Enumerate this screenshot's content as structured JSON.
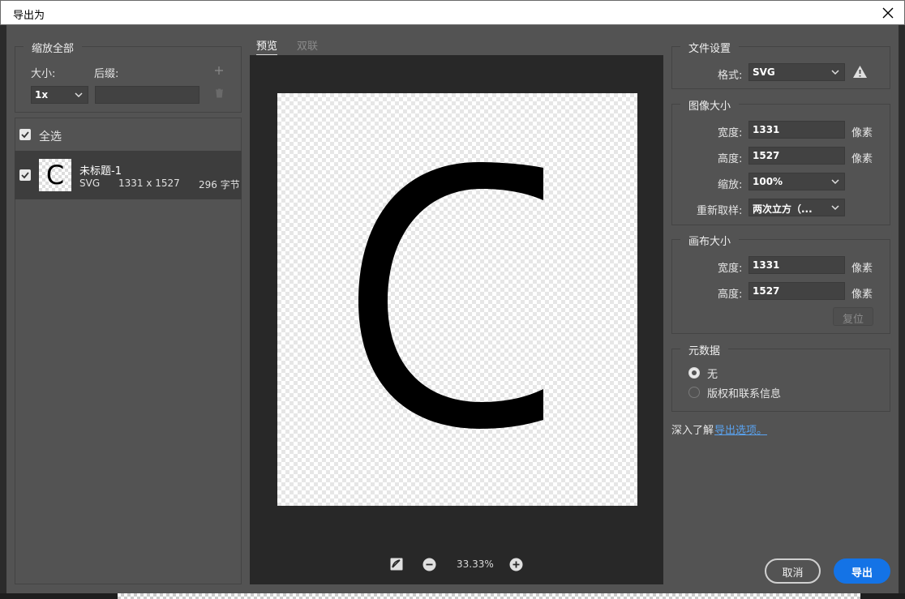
{
  "window": {
    "title": "导出为"
  },
  "scale_all": {
    "legend": "缩放全部",
    "size_label": "大小:",
    "suffix_label": "后缀:",
    "size_value": "1x",
    "suffix_value": ""
  },
  "assets": {
    "select_all_label": "全选",
    "items": [
      {
        "name": "未标题-1",
        "format": "SVG",
        "dimensions": "1331 x 1527",
        "filesize": "296 字节",
        "thumbnail_glyph": "C",
        "checked": true
      }
    ]
  },
  "preview": {
    "tabs": [
      {
        "label": "预览",
        "active": true
      },
      {
        "label": "双联",
        "active": false
      }
    ],
    "canvas_glyph": "C",
    "zoom": "33.33%"
  },
  "file_settings": {
    "legend": "文件设置",
    "format_label": "格式:",
    "format_value": "SVG"
  },
  "image_size": {
    "legend": "图像大小",
    "width_label": "宽度:",
    "width_value": "1331",
    "height_label": "高度:",
    "height_value": "1527",
    "unit": "像素",
    "scale_label": "缩放:",
    "scale_value": "100%",
    "resample_label": "重新取样:",
    "resample_value": "两次立方（..."
  },
  "canvas_size": {
    "legend": "画布大小",
    "width_label": "宽度:",
    "width_value": "1331",
    "height_label": "高度:",
    "height_value": "1527",
    "unit": "像素",
    "reset_label": "复位"
  },
  "metadata": {
    "legend": "元数据",
    "options": [
      {
        "label": "无",
        "selected": true
      },
      {
        "label": "版权和联系信息",
        "selected": false
      }
    ]
  },
  "learn_more": {
    "text": "深入了解",
    "link": "导出选项。"
  },
  "buttons": {
    "cancel": "取消",
    "export": "导出"
  },
  "colors": {
    "accent": "#1473e6",
    "link": "#5aa3f0",
    "panel": "#535353",
    "preview_bg": "#282828"
  }
}
